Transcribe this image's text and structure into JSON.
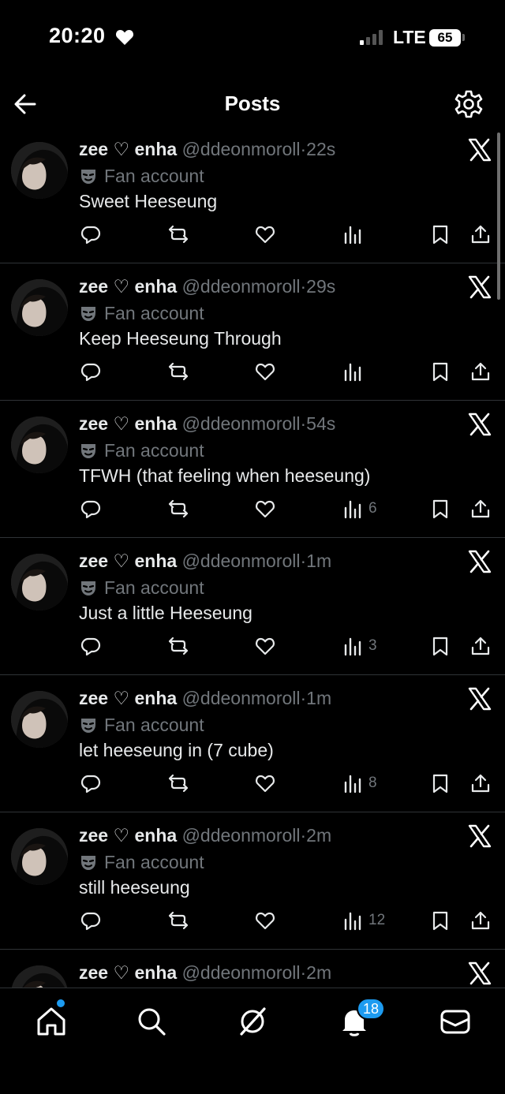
{
  "status_bar": {
    "time": "20:20",
    "network": "LTE",
    "battery": "65"
  },
  "header": {
    "title": "Posts"
  },
  "posts": [
    {
      "name": "zee ♡ enha",
      "handle": "@ddeonmoroll",
      "time": "22s",
      "label": "Fan account",
      "text": "Sweet Heeseung",
      "views": ""
    },
    {
      "name": "zee ♡ enha",
      "handle": "@ddeonmoroll",
      "time": "29s",
      "label": "Fan account",
      "text": "Keep Heeseung Through",
      "views": ""
    },
    {
      "name": "zee ♡ enha",
      "handle": "@ddeonmoroll",
      "time": "54s",
      "label": "Fan account",
      "text": "TFWH (that feeling when heeseung)",
      "views": "6"
    },
    {
      "name": "zee ♡ enha",
      "handle": "@ddeonmoroll",
      "time": "1m",
      "label": "Fan account",
      "text": "Just a little Heeseung",
      "views": "3"
    },
    {
      "name": "zee ♡ enha",
      "handle": "@ddeonmoroll",
      "time": "1m",
      "label": "Fan account",
      "text": "let heeseung in (7 cube)",
      "views": "8"
    },
    {
      "name": "zee ♡ enha",
      "handle": "@ddeonmoroll",
      "time": "2m",
      "label": "Fan account",
      "text": "still heeseung",
      "views": "12"
    },
    {
      "name": "zee ♡ enha",
      "handle": "@ddeonmoroll",
      "time": "2m",
      "label": "Fan account",
      "text": "",
      "views": ""
    }
  ],
  "bottom_nav": {
    "items": [
      "home-icon",
      "search-icon",
      "grok-icon",
      "bell-icon",
      "mail-icon"
    ],
    "notifications_badge": "18"
  },
  "colors": {
    "background": "#000000",
    "text": "#e7e9ea",
    "muted": "#71767b",
    "accent": "#1d9bf0",
    "divider": "#2f3336"
  }
}
